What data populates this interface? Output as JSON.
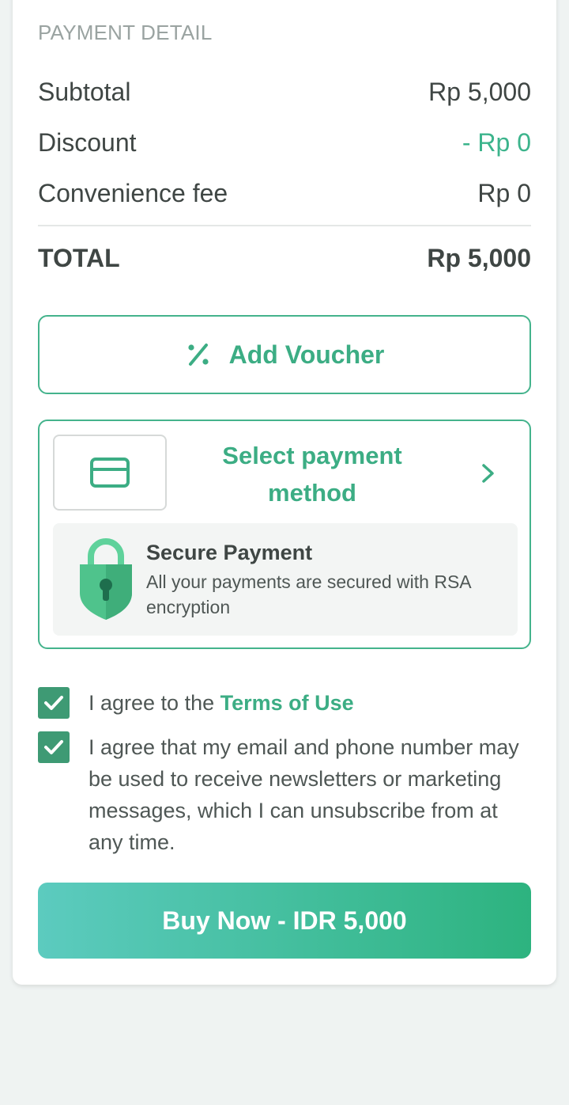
{
  "payment_detail": {
    "title": "PAYMENT DETAIL",
    "rows": [
      {
        "label": "Subtotal",
        "value": "Rp 5,000"
      },
      {
        "label": "Discount",
        "value": "- Rp 0"
      },
      {
        "label": "Convenience fee",
        "value": "Rp 0"
      }
    ],
    "total": {
      "label": "TOTAL",
      "value": "Rp 5,000"
    }
  },
  "voucher": {
    "label": "Add Voucher",
    "icon": "percent-icon"
  },
  "payment_method": {
    "label_line1": "Select payment",
    "label_line2": "method",
    "icon": "credit-card-icon"
  },
  "secure": {
    "title": "Secure Payment",
    "description": "All your payments are secured with RSA encryption",
    "icon": "shield-lock-icon"
  },
  "agreements": {
    "terms_prefix": "I agree to the ",
    "terms_link": "Terms of Use",
    "terms_checked": true,
    "marketing_text": "I agree that my email and phone number may be used to receive newsletters or marketing messages, which I can unsubscribe from at any time.",
    "marketing_checked": true
  },
  "buy_button": {
    "label": "Buy Now - IDR 5,000"
  },
  "colors": {
    "accent": "#3cad84",
    "checkbox": "#3e9a74",
    "background": "#eff3f2"
  }
}
